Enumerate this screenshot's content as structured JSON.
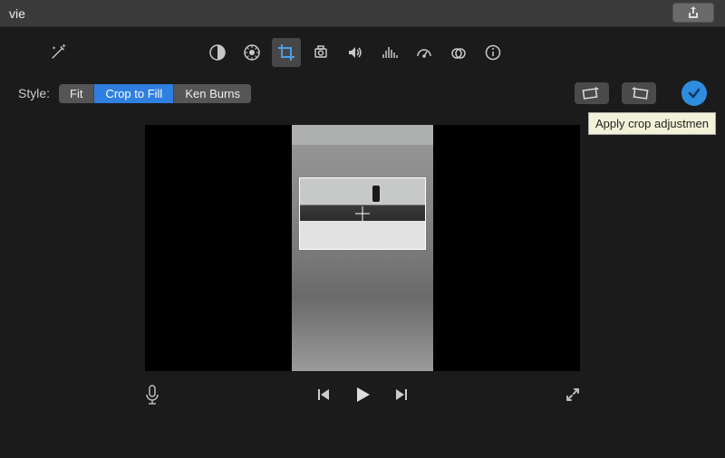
{
  "topbar": {
    "title": "vie"
  },
  "toolbar": {
    "icons": {
      "autoenhance": "sparkle-icon",
      "balance": "balance-icon",
      "color": "color-wheel-icon",
      "crop": "crop-icon",
      "stabilize": "camera-icon",
      "volume": "speaker-icon",
      "eq": "equalizer-icon",
      "speed": "speedometer-icon",
      "filters": "overlap-circles-icon",
      "info": "info-icon"
    }
  },
  "style": {
    "label": "Style:",
    "options": [
      "Fit",
      "Crop to Fill",
      "Ken Burns"
    ],
    "selected_index": 1
  },
  "actions": {
    "rotate_ccw_label": "rotate-ccw",
    "rotate_cw_label": "rotate-cw",
    "apply_tooltip": "Apply crop adjustmen"
  },
  "transport": {
    "mic": "microphone",
    "prev": "previous-frame",
    "play": "play",
    "next": "next-frame",
    "expand": "expand"
  },
  "colors": {
    "accent": "#2f7fe0",
    "apply": "#2f8de0"
  }
}
